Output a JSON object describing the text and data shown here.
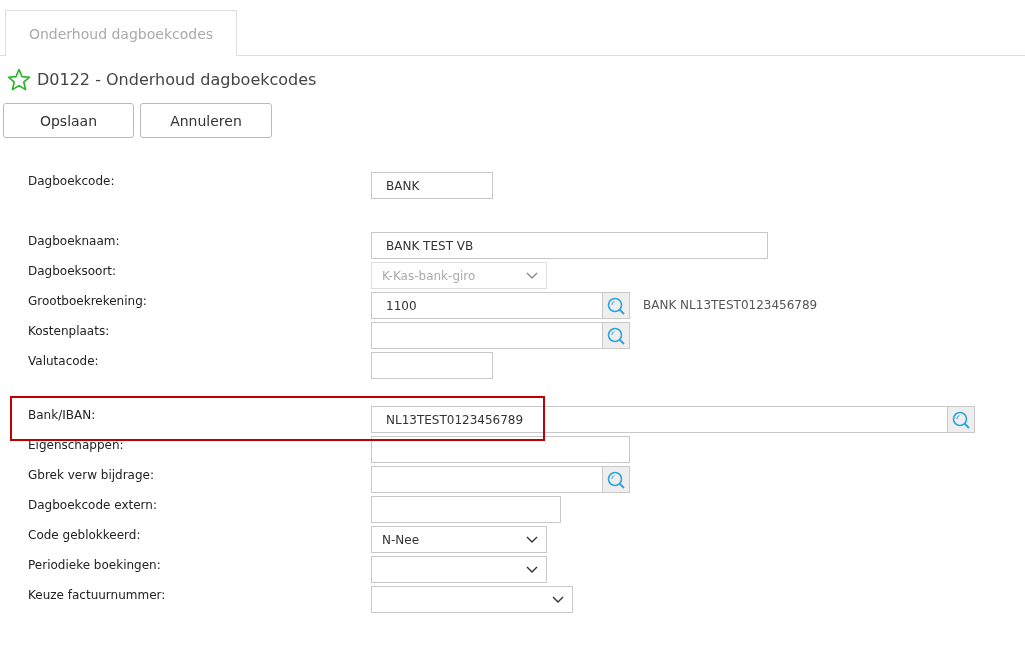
{
  "tabs": [
    {
      "label": "Onderhoud dagboekcodes",
      "selected": false
    }
  ],
  "title": "D0122 - Onderhoud dagboekcodes",
  "buttons": [
    "Opslaan",
    "Annuleren"
  ],
  "sections": [
    {
      "fields": [
        {
          "label": "Dagboekcode:",
          "kind": "text",
          "value": "BANK",
          "highlighted": false
        }
      ]
    },
    {
      "fields": [
        {
          "label": "Dagboeknaam:",
          "kind": "text",
          "value": "BANK TEST VB",
          "highlighted": false
        },
        {
          "label": "Dagboeksoort:",
          "kind": "select",
          "value": "K-Kas-bank-giro",
          "disabled": true,
          "highlighted": false
        },
        {
          "label": "Grootboekrekening:",
          "kind": "lookup",
          "value": "1100",
          "note": "BANK NL13TEST0123456789",
          "highlighted": false
        },
        {
          "label": "Kostenplaats:",
          "kind": "lookup",
          "highlighted": false
        },
        {
          "label": "Valutacode:",
          "kind": "text",
          "highlighted": false
        }
      ]
    },
    {
      "fields": [
        {
          "label": "Bank/IBAN:",
          "kind": "lookup",
          "value": "NL13TEST0123456789",
          "highlighted": true
        },
        {
          "label": "Eigenschappen:",
          "kind": "text",
          "highlighted": false
        },
        {
          "label": "Gbrek verw bijdrage:",
          "kind": "lookup",
          "highlighted": false
        },
        {
          "label": "Dagboekcode extern:",
          "kind": "text",
          "highlighted": false
        },
        {
          "label": "Code geblokkeerd:",
          "kind": "select",
          "value": "N-Nee",
          "disabled": false,
          "highlighted": false
        },
        {
          "label": "Periodieke boekingen:",
          "kind": "select",
          "disabled": false,
          "highlighted": false
        },
        {
          "label": "Keuze factuurnummer:",
          "kind": "select",
          "disabled": false,
          "highlighted": false
        }
      ]
    }
  ]
}
